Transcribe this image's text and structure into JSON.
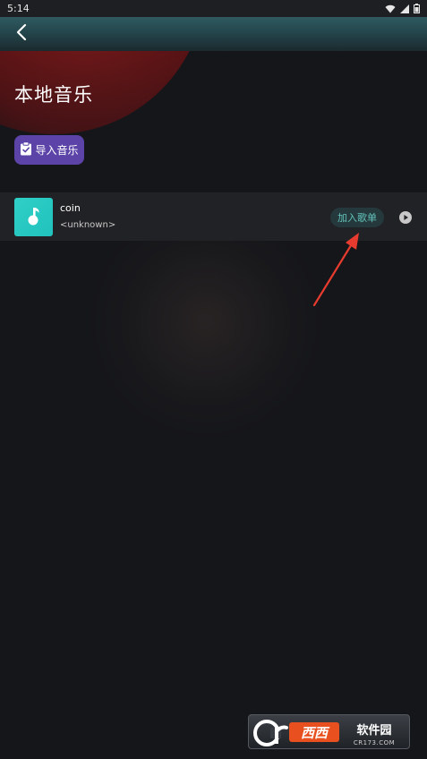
{
  "status_bar": {
    "time": "5:14"
  },
  "page": {
    "title": "本地音乐",
    "import_button_label": "导入音乐"
  },
  "songs": [
    {
      "title": "coin",
      "artist": "<unknown>",
      "add_label": "加入歌单",
      "cover_icon": "music-note-icon",
      "play_icon": "play-circle-icon"
    }
  ],
  "watermark": {
    "logo_text": "西西软件园",
    "url_text": "CR173.COM"
  },
  "colors": {
    "accent_purple": "#5b43a8",
    "cover_teal": "#2fd0c6",
    "add_text_teal": "#63c3bb",
    "annotation_arrow": "#e63b2e"
  }
}
